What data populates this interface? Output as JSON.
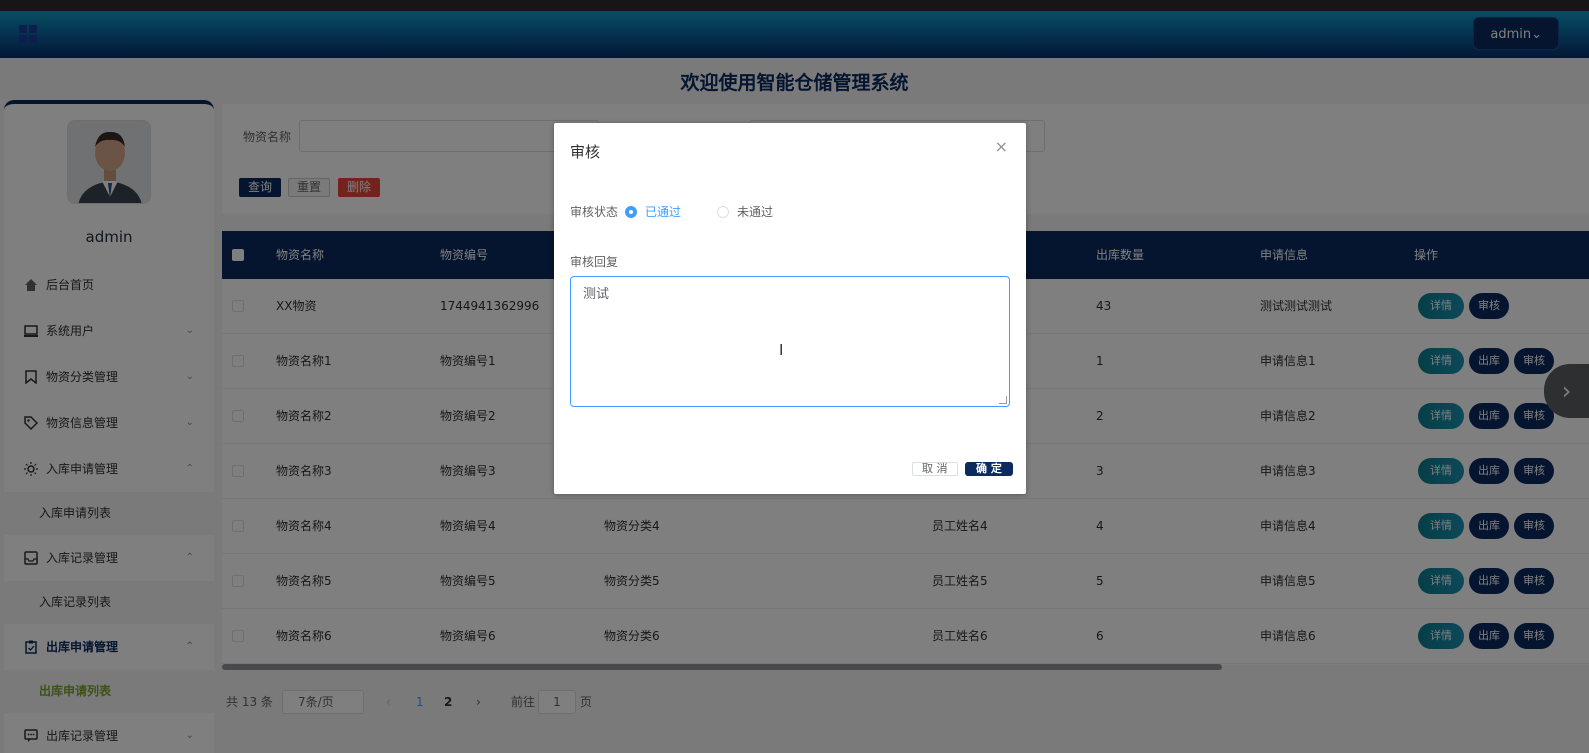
{
  "header": {
    "admin_label": "admin⌄"
  },
  "welcome": "欢迎使用智能仓储管理系统",
  "sidebar": {
    "username": "admin",
    "items": [
      {
        "label": "后台首页",
        "icon": "home-icon",
        "chevron": ""
      },
      {
        "label": "系统用户",
        "icon": "monitor-icon",
        "chevron": "⌄"
      },
      {
        "label": "物资分类管理",
        "icon": "bookmark-icon",
        "chevron": "⌄"
      },
      {
        "label": "物资信息管理",
        "icon": "tag-icon",
        "chevron": "⌄"
      },
      {
        "label": "入库申请管理",
        "icon": "sun-icon",
        "chevron": "⌃"
      },
      {
        "label": "入库记录管理",
        "icon": "inbox-icon",
        "chevron": "⌃"
      },
      {
        "label": "出库申请管理",
        "icon": "clipboard-icon",
        "chevron": "⌃"
      },
      {
        "label": "出库记录管理",
        "icon": "message-icon",
        "chevron": "⌄"
      }
    ],
    "subs": {
      "inbound_apply_list": "入库申请列表",
      "inbound_record_list": "入库记录列表",
      "outbound_apply_list": "出库申请列表"
    }
  },
  "search": {
    "name_label": "物资名称",
    "query": "查询",
    "reset": "重置",
    "delete": "删除"
  },
  "table": {
    "headers": [
      "物资名称",
      "物资编号",
      "出库数量",
      "申请信息",
      "操作"
    ],
    "rows": [
      {
        "name": "XX物资",
        "code": "1744941362996",
        "category": "",
        "employee": "",
        "qty": "43",
        "info": "测试测试测试"
      },
      {
        "name": "物资名称1",
        "code": "物资编号1",
        "category": "",
        "employee": "",
        "qty": "1",
        "info": "申请信息1"
      },
      {
        "name": "物资名称2",
        "code": "物资编号2",
        "category": "",
        "employee": "",
        "qty": "2",
        "info": "申请信息2"
      },
      {
        "name": "物资名称3",
        "code": "物资编号3",
        "category": "",
        "employee": "",
        "qty": "3",
        "info": "申请信息3"
      },
      {
        "name": "物资名称4",
        "code": "物资编号4",
        "category": "物资分类4",
        "employee": "员工姓名4",
        "qty": "4",
        "info": "申请信息4"
      },
      {
        "name": "物资名称5",
        "code": "物资编号5",
        "category": "物资分类5",
        "employee": "员工姓名5",
        "qty": "5",
        "info": "申请信息5"
      },
      {
        "name": "物资名称6",
        "code": "物资编号6",
        "category": "物资分类6",
        "employee": "员工姓名6",
        "qty": "6",
        "info": "申请信息6"
      }
    ],
    "actions": {
      "detail": "详情",
      "outbound": "出库",
      "review": "审核"
    }
  },
  "pager": {
    "total": "共 13 条",
    "size": "7条/页",
    "prev": "‹",
    "p1": "1",
    "p2": "2",
    "next": "›",
    "goto": "前往",
    "goto_value": "1",
    "page_unit": "页"
  },
  "dialog": {
    "title": "审核",
    "close": "×",
    "status_label": "审核状态",
    "approved": "已通过",
    "rejected": "未通过",
    "reply_label": "审核回复",
    "reply_value": "测试",
    "cancel": "取 消",
    "confirm": "确 定"
  },
  "colors": {
    "primary": "#0b2a5e",
    "accent": "#409eff",
    "danger": "#e8453c",
    "active_sub": "#7aa42a"
  }
}
